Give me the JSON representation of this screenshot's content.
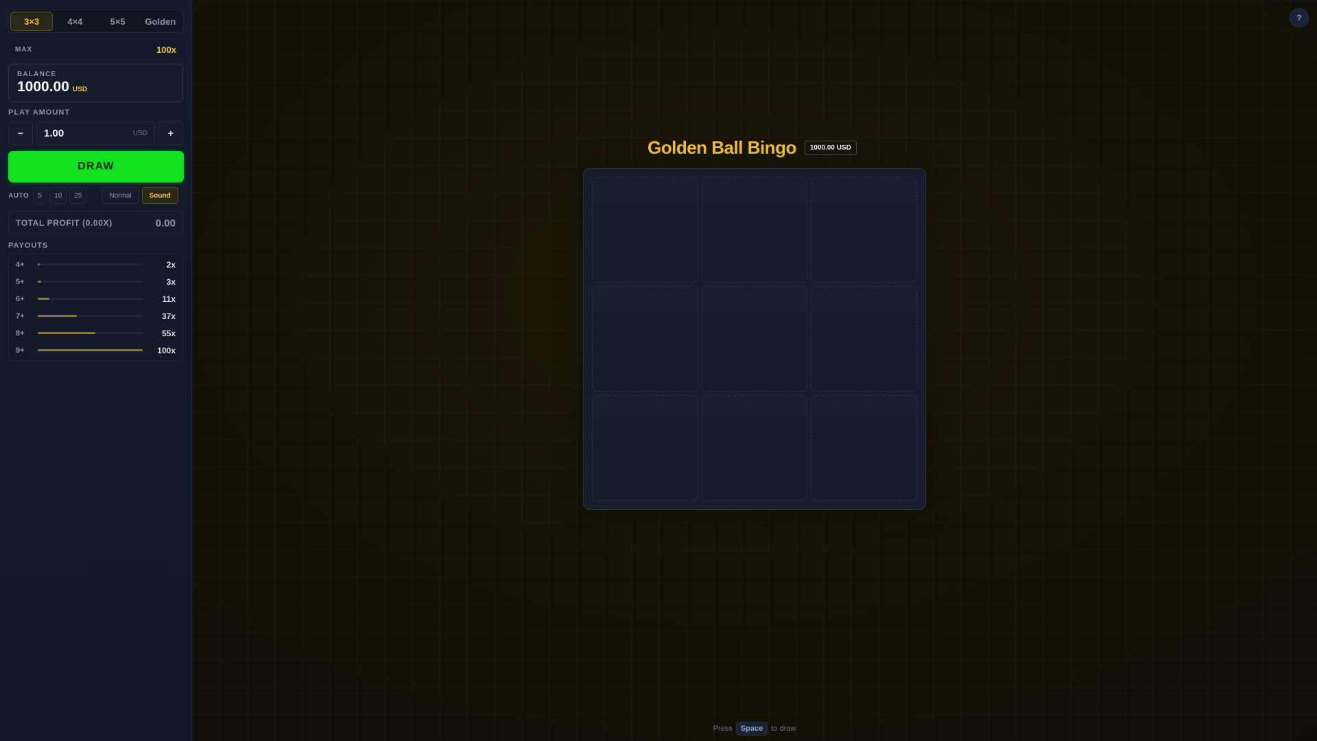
{
  "sidebar": {
    "mode_tabs": [
      {
        "label": "3×3",
        "active": true
      },
      {
        "label": "4×4",
        "active": false
      },
      {
        "label": "5×5",
        "active": false
      },
      {
        "label": "Golden",
        "active": false
      }
    ],
    "max": {
      "label": "MAX",
      "value": "100x"
    },
    "balance": {
      "label": "BALANCE",
      "value": "1000.00",
      "currency": "USD"
    },
    "play_amount": {
      "label": "PLAY AMOUNT",
      "minus": "−",
      "value": "1.00",
      "currency": "USD",
      "plus": "+"
    },
    "draw_label": "DRAW",
    "auto": {
      "label": "AUTO",
      "options": [
        "5",
        "10",
        "25"
      ]
    },
    "speed_label": "Normal",
    "sound_label": "Sound",
    "profit": {
      "label": "TOTAL PROFIT (0.00X)",
      "value": "0.00"
    },
    "payouts": {
      "label": "PAYOUTS",
      "rows": [
        {
          "hits": "4+",
          "mult": "2x",
          "level": 0.02
        },
        {
          "hits": "5+",
          "mult": "3x",
          "level": 0.03
        },
        {
          "hits": "6+",
          "mult": "11x",
          "level": 0.11
        },
        {
          "hits": "7+",
          "mult": "37x",
          "level": 0.37
        },
        {
          "hits": "8+",
          "mult": "55x",
          "level": 0.55
        },
        {
          "hits": "9+",
          "mult": "100x",
          "level": 1.0
        }
      ]
    }
  },
  "main": {
    "help_label": "?",
    "title": "Golden Ball Bingo",
    "balance_badge": "1000.00 USD",
    "board": {
      "rows": 3,
      "cols": 3
    },
    "hint": {
      "prefix": "Press",
      "key": "Space",
      "suffix": "to draw"
    }
  },
  "colors": {
    "accent": "#f2c132",
    "draw_button": "#10e01e",
    "sidebar_bg": "#141c2c",
    "page_bg": "#151106"
  }
}
